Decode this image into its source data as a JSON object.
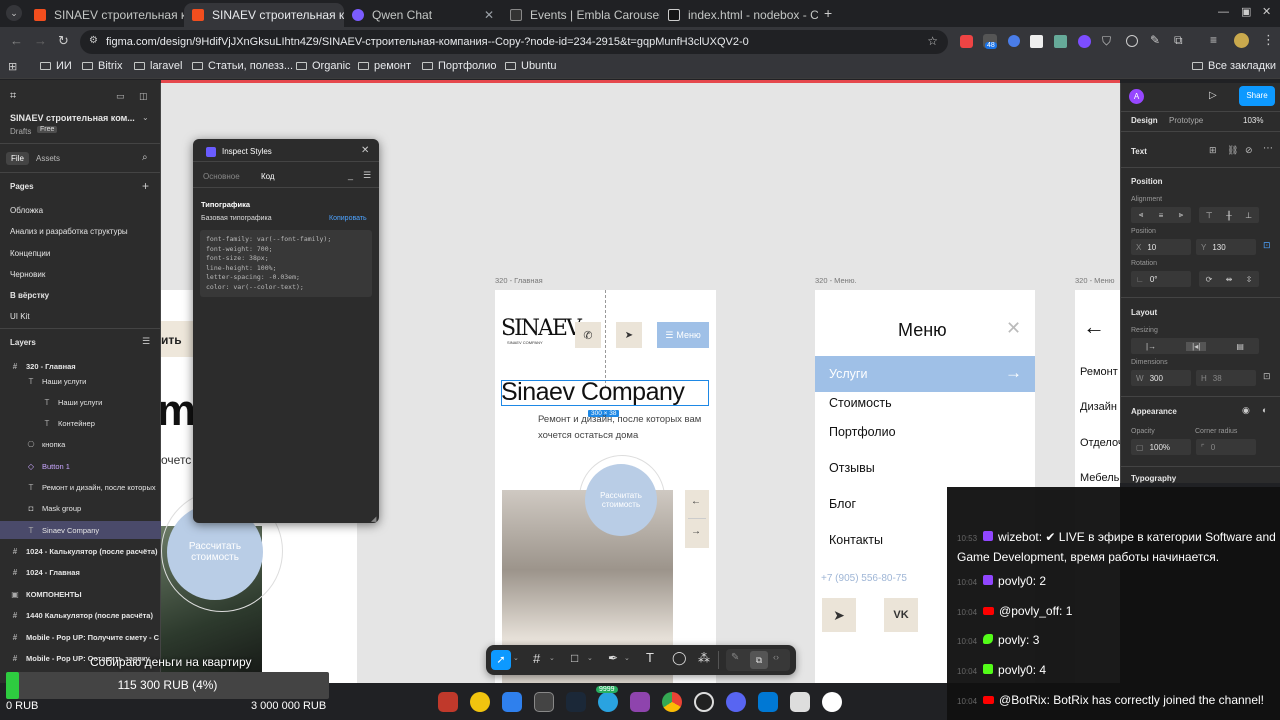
{
  "browser": {
    "tabs": [
      {
        "label": "SINAEV строительная к",
        "favicon": "figma",
        "active": false
      },
      {
        "label": "SINAEV строительная к",
        "favicon": "figma",
        "active": true
      },
      {
        "label": "Qwen Chat",
        "favicon": "qwen",
        "active": false
      },
      {
        "label": "Events | Embla Carousel",
        "favicon": "embla",
        "active": false
      },
      {
        "label": "index.html - nodebox - C",
        "favicon": "codesandbox",
        "active": false
      }
    ],
    "url": "figma.com/design/9HdifVjJXnGksuLIhtn4Z9/SINAEV-строительная-компания--Copy-?node-id=234-2915&t=gqpMunfH3clUXQV2-0",
    "extension_badge": "48",
    "bookmarks": [
      "ИИ",
      "Bitrix",
      "laravel",
      "Статьи, полезз...",
      "Organic",
      "ремонт",
      "Портфолио",
      "Ubuntu"
    ],
    "all_bookmarks": "Все закладки"
  },
  "figma": {
    "file_name": "SINAEV строительная ком...",
    "drafts": "Drafts",
    "plan": "Free",
    "left_tabs": [
      "File",
      "Assets"
    ],
    "pages_title": "Pages",
    "pages": [
      "Обложка",
      "Анализ и разработка структуры",
      "Концепции",
      "Черновик",
      "В вёрстку",
      "UI Kit"
    ],
    "layers_title": "Layers",
    "layers": [
      {
        "label": "320 - Главная",
        "icon": "frame-icon",
        "bold": true
      },
      {
        "label": "Наши услуги",
        "icon": "text-icon"
      },
      {
        "label": "Наши услуги",
        "icon": "text-icon"
      },
      {
        "label": "Контейнер",
        "icon": "text-icon"
      },
      {
        "label": "кнопка",
        "icon": "component-icon"
      },
      {
        "label": "Button 1",
        "icon": "instance-icon"
      },
      {
        "label": "Ремонт и дизайн, после которых",
        "icon": "text-icon"
      },
      {
        "label": "Mask group",
        "icon": "mask-icon"
      },
      {
        "label": "Sinaev Company",
        "icon": "text-icon",
        "selected": true
      },
      {
        "label": "1024 - Калькулятор  (после расчёта)",
        "icon": "frame-icon",
        "bold": true
      },
      {
        "label": "1024 - Главная",
        "icon": "frame-icon",
        "bold": true
      },
      {
        "label": "КОМПОНЕНТЫ",
        "icon": "section-icon",
        "bold": true
      },
      {
        "label": "1440 Калькулятор  (после расчёта)",
        "icon": "frame-icon",
        "bold": true
      },
      {
        "label": "Mobile - Pop UP:  Получите смету - С",
        "icon": "frame-icon",
        "bold": true
      },
      {
        "label": "Mobile - Pop UP:  Оставить заявку",
        "icon": "frame-icon",
        "bold": true
      }
    ],
    "right": {
      "tabs": [
        "Design",
        "Prototype"
      ],
      "zoom": "103%",
      "avatar": "A",
      "share": "Share",
      "section": "Text",
      "position": "Position",
      "alignment": "Alignment",
      "position_label": "Position",
      "x": "10",
      "y": "130",
      "rotation_label": "Rotation",
      "rotation": "0°",
      "layout": "Layout",
      "resizing": "Resizing",
      "dimensions": "Dimensions",
      "w": "300",
      "h": "38",
      "appearance": "Appearance",
      "opacity_label": "Opacity",
      "opacity": "100%",
      "corner_label": "Corner radius",
      "corner": "0",
      "typography": "Typography"
    },
    "inspect": {
      "title": "Inspect Styles",
      "tabs": [
        "Основное",
        "Код"
      ],
      "section": "Типографика",
      "subsection": "Базовая типографика",
      "copy": "Копировать",
      "code": "font-family: var(--font-family);\nfont-weight: 700;\nfont-size: 38px;\nline-height: 100%;\nletter-spacing: -0.03em;\ncolor: var(--color-text);"
    },
    "frames": {
      "main_label": "320 - Главная",
      "menu_label": "320 - Меню.",
      "third_label": "320 - Меню",
      "logo": "SINAEV",
      "logo_sub": "SINAEV COMPANY",
      "menu_button": "Меню",
      "heading": "Sinaev Company",
      "size_badge": "300 × 38",
      "subtitle_line1": "Ремонт и дизайн, после которых вам",
      "subtitle_line2": "хочется остаться дома",
      "calc_line1": "Рассчитать",
      "calc_line2": "стоимость",
      "arrow_left": "←",
      "arrow_right": "→",
      "menu_title": "Меню",
      "menu_items": [
        "Услуги",
        "Стоимость",
        "Портфолио",
        "Отзывы",
        "Блог",
        "Контакты"
      ],
      "phone": "+7 (905) 556-80-75",
      "third_items": [
        "Ремонт",
        "Дизайн",
        "Отделоч",
        "Мебель"
      ],
      "left_button": "ить",
      "left_big": "mp",
      "left_small": "очетс"
    }
  },
  "chat": [
    {
      "time": "10:53",
      "icon_color": "#9146ff",
      "user": "wizebot",
      "text": "✔ LIVE в эфире в категории Software and Game Development, время работы начинается."
    },
    {
      "time": "10:04",
      "icon_color": "#9146ff",
      "user": "povly0",
      "text": "2"
    },
    {
      "time": "10:04",
      "icon_color": "#ff0000",
      "user": "@povly_off",
      "text": "1"
    },
    {
      "time": "10:04",
      "icon_color": "#53fc18",
      "user": "povly",
      "text": "3"
    },
    {
      "time": "10:04",
      "icon_color": "#53fc18",
      "user": "povly0",
      "text": "4"
    },
    {
      "time": "10:04",
      "icon_color": "#ff0000",
      "user": "@BotRix",
      "text": "BotRix has correctly joined the channel!"
    }
  ],
  "donation": {
    "title": "Собираю деньги на квартиру",
    "current": "115 300 RUB (4%)",
    "progress": 0.04,
    "min": "0 RUB",
    "max": "3 000 000 RUB"
  },
  "dock": {
    "badge": "9999"
  }
}
